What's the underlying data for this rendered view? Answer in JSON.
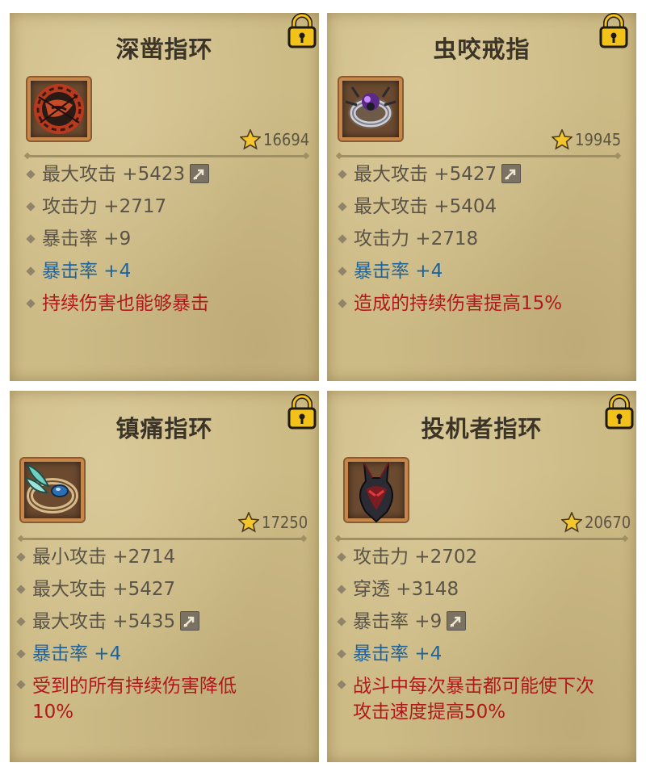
{
  "cards": [
    {
      "name": "深凿指环",
      "score": "16694",
      "stats": [
        {
          "text": "最大攻击 +5423",
          "color": "normal",
          "upgradable": true
        },
        {
          "text": "攻击力 +2717",
          "color": "normal",
          "upgradable": false
        },
        {
          "text": "暴击率 +9",
          "color": "normal",
          "upgradable": false
        },
        {
          "text": "暴击率 +4",
          "color": "blue",
          "upgradable": false
        },
        {
          "text": "持续伤害也能够暴击",
          "color": "red",
          "upgradable": false
        }
      ],
      "icon": "molten-ring-icon"
    },
    {
      "name": "虫咬戒指",
      "score": "19945",
      "stats": [
        {
          "text": "最大攻击 +5427",
          "color": "normal",
          "upgradable": true
        },
        {
          "text": "最大攻击 +5404",
          "color": "normal",
          "upgradable": false
        },
        {
          "text": "攻击力 +2718",
          "color": "normal",
          "upgradable": false
        },
        {
          "text": "暴击率 +4",
          "color": "blue",
          "upgradable": false
        },
        {
          "text": "造成的持续伤害提高15%",
          "color": "red",
          "upgradable": false
        }
      ],
      "icon": "spider-ring-icon"
    },
    {
      "name": "镇痛指环",
      "score": "17250",
      "stats": [
        {
          "text": "最小攻击 +2714",
          "color": "normal",
          "upgradable": false
        },
        {
          "text": "最大攻击 +5427",
          "color": "normal",
          "upgradable": false
        },
        {
          "text": "最大攻击 +5435",
          "color": "normal",
          "upgradable": true
        },
        {
          "text": "暴击率 +4",
          "color": "blue",
          "upgradable": false
        },
        {
          "text": "受到的所有持续伤害降低10%",
          "color": "red",
          "upgradable": false
        }
      ],
      "icon": "feather-ring-icon"
    },
    {
      "name": "投机者指环",
      "score": "20670",
      "stats": [
        {
          "text": "攻击力 +2702",
          "color": "normal",
          "upgradable": false
        },
        {
          "text": "穿透 +3148",
          "color": "normal",
          "upgradable": false
        },
        {
          "text": "暴击率 +9",
          "color": "normal",
          "upgradable": true
        },
        {
          "text": "暴击率 +4",
          "color": "blue",
          "upgradable": false
        },
        {
          "text": "战斗中每次暴击都可能使下次攻击速度提高50%",
          "color": "red",
          "upgradable": false
        }
      ],
      "icon": "dark-ring-icon"
    }
  ],
  "icons": {
    "lock": "lock-icon",
    "star": "star-icon",
    "upgrade": "upgrade-arrow-icon"
  },
  "colors": {
    "card_bg": "#cdbb86",
    "stat_normal": "#5a5347",
    "stat_blue": "#20639a",
    "stat_red": "#b0191c",
    "lock_gold": "#f2c21b"
  }
}
